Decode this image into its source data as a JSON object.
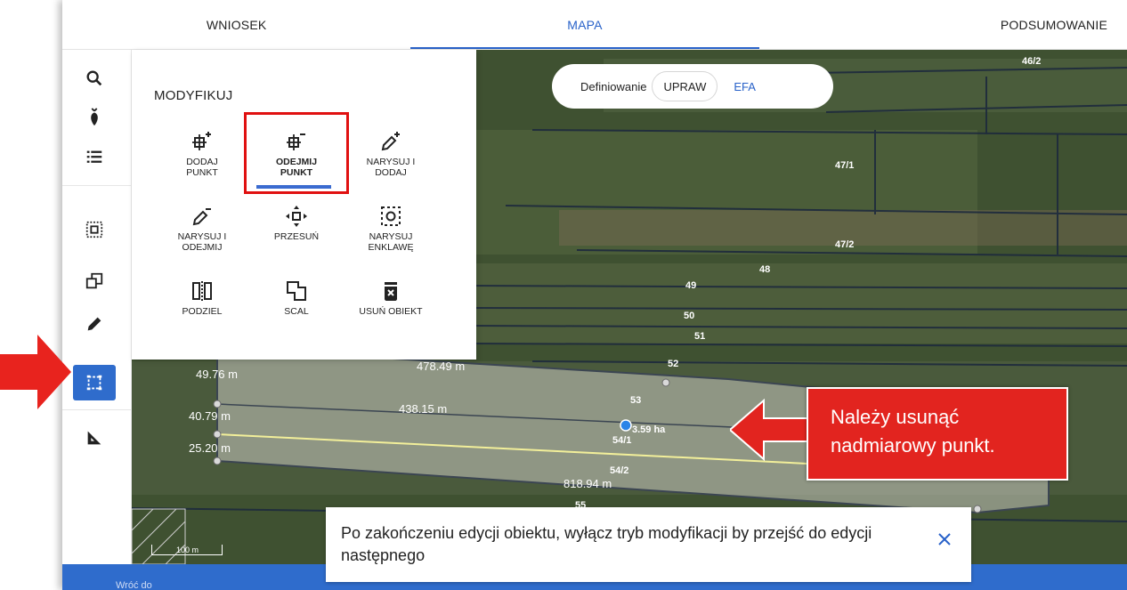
{
  "tabs": [
    {
      "label": "WNIOSEK",
      "active": false
    },
    {
      "label": "MAPA",
      "active": true
    },
    {
      "label": "PODSUMOWANIE",
      "active": false
    }
  ],
  "toolbar": {
    "icons": [
      "search-icon",
      "plant-icon",
      "list-icon",
      "select-area-icon",
      "copy-shape-icon",
      "pencil-icon",
      "modify-icon",
      "ruler-icon"
    ],
    "active": "modify-icon"
  },
  "modify_panel": {
    "title": "MODYFIKUJ",
    "tools": [
      {
        "label": "DODAJ\nPUNKT",
        "icon": "add-point-icon",
        "selected": false
      },
      {
        "label": "ODEJMIJ\nPUNKT",
        "icon": "remove-point-icon",
        "selected": true
      },
      {
        "label": "NARYSUJ I\nDODAJ",
        "icon": "draw-add-icon",
        "selected": false
      },
      {
        "label": "NARYSUJ I\nODEJMIJ",
        "icon": "draw-subtract-icon",
        "selected": false
      },
      {
        "label": "PRZESUŃ",
        "icon": "move-icon",
        "selected": false
      },
      {
        "label": "NARYSUJ\nENKLAWĘ",
        "icon": "enclave-icon",
        "selected": false
      },
      {
        "label": "PODZIEL",
        "icon": "split-icon",
        "selected": false
      },
      {
        "label": "SCAL",
        "icon": "merge-icon",
        "selected": false
      },
      {
        "label": "USUŃ OBIEKT",
        "icon": "delete-icon",
        "selected": false
      }
    ]
  },
  "definition": {
    "label": "Definiowanie",
    "options": [
      "UPRAW",
      "EFA"
    ],
    "selected": "UPRAW"
  },
  "map": {
    "parcel_labels": [
      "46/2",
      "47/1",
      "47/2",
      "48",
      "49",
      "50",
      "51",
      "52",
      "53",
      "54/1",
      "54/2",
      "55"
    ],
    "measurements": [
      "49.76 m",
      "40.79 m",
      "25.20 m",
      "478.49 m",
      "438.15 m",
      "818.94 m"
    ],
    "area_label": "3.59 ha",
    "scale_label": "100 m"
  },
  "callout": {
    "line1": "Należy usunąć",
    "line2": "nadmiarowy punkt."
  },
  "info_bar": {
    "text": "Po zakończeniu edycji obiektu, wyłącz tryb modyfikacji by przejść do edycji następnego"
  },
  "bottom_bar": {
    "back_label": "Wróć do"
  },
  "colors": {
    "accent": "#2962c9",
    "active_tool": "#2f6ccc",
    "highlight_red": "#e01010",
    "callout_red": "#e2241f"
  }
}
